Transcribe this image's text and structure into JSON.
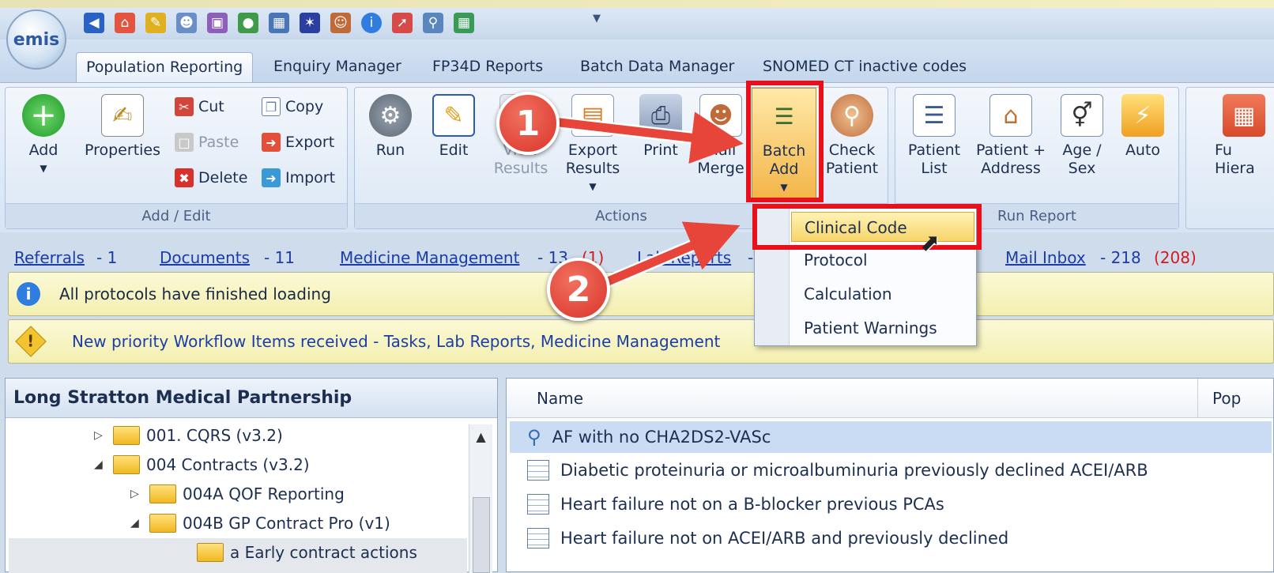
{
  "app": {
    "logo_text": "emis"
  },
  "qat_icons": [
    "back-icon",
    "home-icon",
    "pencil-icon",
    "user-search-icon",
    "notepad-icon",
    "globe-icon",
    "calendar-icon",
    "atom-icon",
    "users-icon",
    "info-icon",
    "syringe-icon",
    "search-doc-icon",
    "grid-icon"
  ],
  "tabs": [
    {
      "label": "Population Reporting",
      "active": true
    },
    {
      "label": "Enquiry Manager",
      "active": false
    },
    {
      "label": "FP34D Reports",
      "active": false
    },
    {
      "label": "Batch Data Manager",
      "active": false
    },
    {
      "label": "SNOMED CT inactive codes",
      "active": false
    }
  ],
  "ribbon": {
    "add_edit": {
      "label": "Add / Edit",
      "add": "Add",
      "properties": "Properties",
      "cut": "Cut",
      "paste": "Paste",
      "delete": "Delete",
      "copy": "Copy",
      "export": "Export",
      "import": "Import"
    },
    "actions": {
      "label": "Actions",
      "run": "Run",
      "edit": "Edit",
      "view_results_1": "View",
      "view_results_2": "Results",
      "export_results_1": "Export",
      "export_results_2": "Results",
      "print": "Print",
      "mail_merge_1": "Mail",
      "mail_merge_2": "Merge",
      "batch_add_1": "Batch",
      "batch_add_2": "Add",
      "check_patient_1": "Check",
      "check_patient_2": "Patient"
    },
    "run_report": {
      "label": "Run Report",
      "patient_list_1": "Patient",
      "patient_list_2": "List",
      "patient_address_1": "Patient +",
      "patient_address_2": "Address",
      "age_sex_1": "Age /",
      "age_sex_2": "Sex",
      "auto": "Auto"
    },
    "partial": {
      "full_hierarchy_1": "Fu",
      "full_hierarchy_2": "Hiera"
    }
  },
  "batch_menu": {
    "items": [
      "Clinical Code",
      "Protocol",
      "Calculation",
      "Patient Warnings"
    ]
  },
  "nav": {
    "referrals": "Referrals",
    "referrals_count": "- 1",
    "documents": "Documents",
    "documents_count": "- 11",
    "medicine": "Medicine Management",
    "medicine_count": "- 13",
    "medicine_red": "(1)",
    "lab": "Lab Reports",
    "lab_count": "-",
    "mail": "Mail Inbox",
    "mail_count": "- 218",
    "mail_red": "(208)"
  },
  "notices": {
    "info": "All protocols have finished loading",
    "warning": "New priority Workflow Items received - Tasks, Lab Reports, Medicine Management"
  },
  "tree": {
    "title": "Long Stratton Medical Partnership",
    "nodes": [
      {
        "label": "001. CQRS (v3.2)"
      },
      {
        "label": "004 Contracts (v3.2)"
      },
      {
        "label": "004A QOF Reporting"
      },
      {
        "label": "004B GP Contract Pro (v1)"
      },
      {
        "label": "a Early contract actions"
      }
    ]
  },
  "list": {
    "columns": [
      "Name",
      "Pop"
    ],
    "rows": [
      "AF with no CHA2DS2-VASc",
      "Diabetic proteinuria or microalbuminuria previously declined ACEI/ARB",
      "Heart failure not on a B-blocker previous PCAs",
      "Heart failure not on ACEI/ARB and previously declined"
    ]
  },
  "annotations": {
    "step1": "1",
    "step2": "2"
  },
  "colors": {
    "highlight_red": "#e8101a",
    "badge_red": "#d8352a",
    "link_blue": "#1b3da8"
  }
}
